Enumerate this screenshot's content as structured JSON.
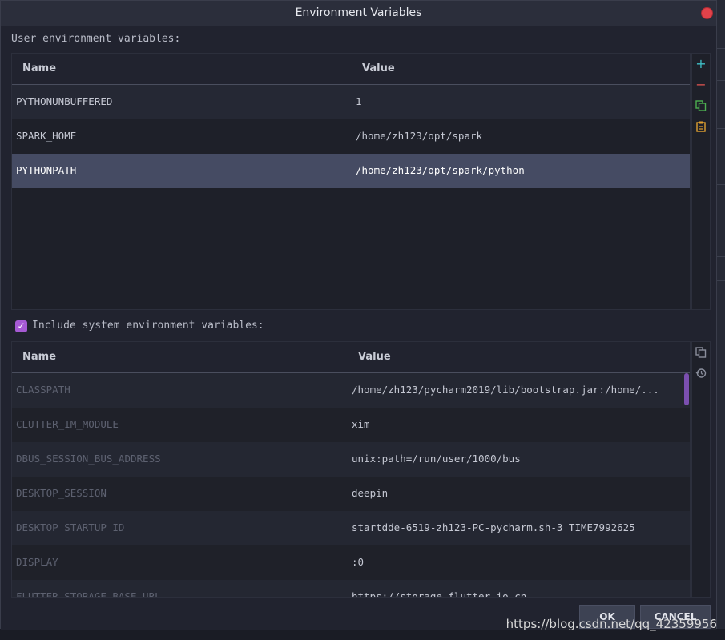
{
  "dialog": {
    "title": "Environment Variables"
  },
  "user_section": {
    "label": "User environment variables:",
    "columns": [
      "Name",
      "Value"
    ],
    "rows": [
      {
        "name": "PYTHONUNBUFFERED",
        "value": "1"
      },
      {
        "name": "SPARK_HOME",
        "value": "/home/zh123/opt/spark"
      },
      {
        "name": "PYTHONPATH",
        "value": "/home/zh123/opt/spark/python"
      }
    ],
    "selected_row": "PYTHONPATH",
    "toolbar": {
      "add_icon": "+",
      "remove_icon": "−"
    }
  },
  "system_section": {
    "checkbox_label": "Include system environment variables:",
    "checked": true,
    "columns": [
      "Name",
      "Value"
    ],
    "rows": [
      {
        "name": "CLASSPATH",
        "value": "/home/zh123/pycharm2019/lib/bootstrap.jar:/home/..."
      },
      {
        "name": "CLUTTER_IM_MODULE",
        "value": "xim"
      },
      {
        "name": "DBUS_SESSION_BUS_ADDRESS",
        "value": "unix:path=/run/user/1000/bus"
      },
      {
        "name": "DESKTOP_SESSION",
        "value": "deepin"
      },
      {
        "name": "DESKTOP_STARTUP_ID",
        "value": "startdde-6519-zh123-PC-pycharm.sh-3_TIME7992625"
      },
      {
        "name": "DISPLAY",
        "value": ":0"
      },
      {
        "name": "FLUTTER_STORAGE_BASE_URL",
        "value": "https://storage.flutter-io.cn"
      }
    ]
  },
  "buttons": {
    "ok": "OK",
    "cancel": "CANCEL"
  },
  "watermark": "https://blog.csdn.net/qq_42359956",
  "colors": {
    "accent": "#a65ad4",
    "add": "#3fbfc7",
    "remove": "#d9534f",
    "copy": "#4caf50",
    "paste": "#e0a030",
    "selected_row": "#454b63"
  }
}
